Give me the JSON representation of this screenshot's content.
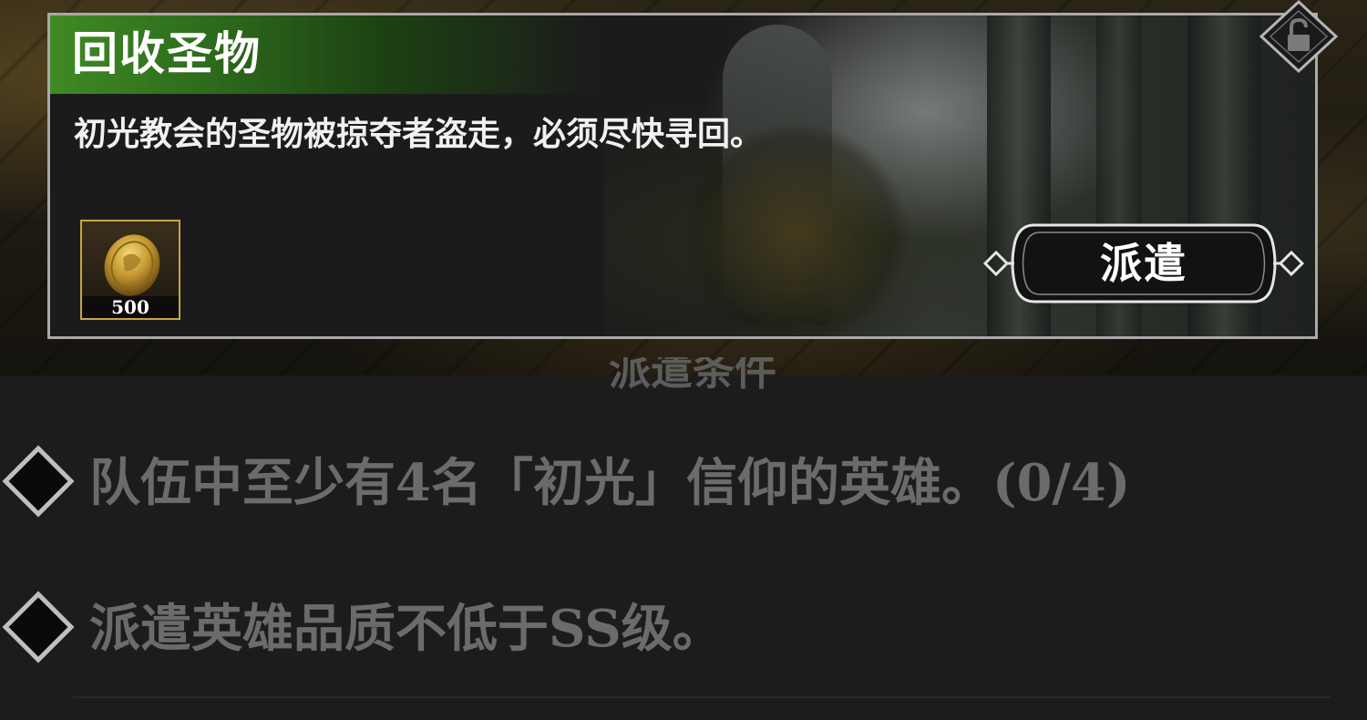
{
  "quest": {
    "title": "回收圣物",
    "description": "初光教会的圣物被掠夺者盗走，必须尽快寻回。",
    "reward": {
      "icon": "gold-coin-icon",
      "count": "500"
    },
    "dispatch_label": "派遣",
    "lock_icon": "lock-icon"
  },
  "requirements": {
    "heading": "派遣条件",
    "items": [
      {
        "text": "队伍中至少有4名「初光」信仰的英雄。(0/4)"
      },
      {
        "text": "派遣英雄品质不低于SS级。"
      }
    ]
  },
  "colors": {
    "title_bar_green": "#3f8a24",
    "reward_border_gold": "#c8a443",
    "card_border": "#a9a9a9",
    "requirement_text_gray": "#6b6b6b"
  }
}
